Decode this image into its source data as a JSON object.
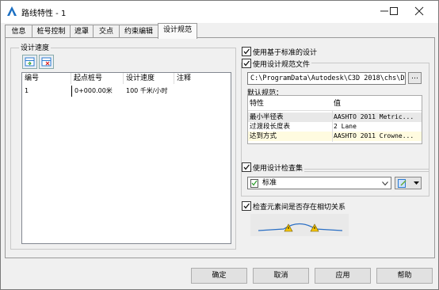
{
  "window": {
    "title": "路线特性 - 1"
  },
  "tabs": [
    {
      "label": "信息"
    },
    {
      "label": "桩号控制"
    },
    {
      "label": "遮罩"
    },
    {
      "label": "交点"
    },
    {
      "label": "约束编辑"
    },
    {
      "label": "设计规范"
    }
  ],
  "design_speed": {
    "group_title": "设计速度",
    "columns": [
      "编号",
      "起点桩号",
      "设计速度",
      "注释"
    ],
    "rows": [
      {
        "id": "1",
        "start_station": "0+000.00米",
        "speed": "100 千米/小时",
        "note": ""
      }
    ]
  },
  "criteria": {
    "use_criteria_label": "使用基于标准的设计",
    "use_criteria_checked": true,
    "use_file_label": "使用设计规范文件",
    "use_file_checked": true,
    "file_path": "C:\\ProgramData\\Autodesk\\C3D 2018\\chs\\D",
    "browse_label": "…",
    "default_criteria_label": "默认规范：",
    "table_headers": [
      "特性",
      "值"
    ],
    "table_rows": [
      {
        "property": "最小半径表",
        "value": "AASHTO 2011 Metric..."
      },
      {
        "property": "过渡段长度表",
        "value": "2 Lane"
      },
      {
        "property": "达到方式",
        "value": "AASHTO 2011 Crowne..."
      }
    ]
  },
  "check_set": {
    "label": "使用设计检查集",
    "checked": true,
    "selected": "标准"
  },
  "tangency": {
    "label": "检查元素间是否存在相切关系",
    "checked": true
  },
  "buttons": {
    "ok": "确定",
    "cancel": "取消",
    "apply": "应用",
    "help": "帮助"
  }
}
